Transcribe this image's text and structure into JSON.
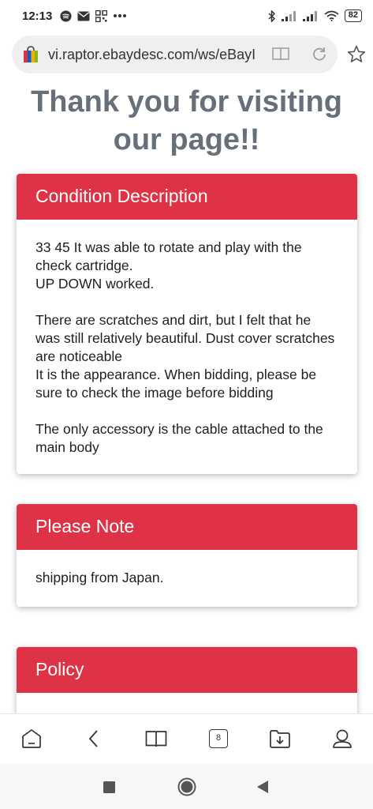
{
  "status_bar": {
    "time": "12:13",
    "battery": "82"
  },
  "browser": {
    "url": "vi.raptor.ebaydesc.com/ws/eBayIS",
    "tab_count": "8"
  },
  "page": {
    "title": "Thank you for visiting our page!!",
    "cards": [
      {
        "header": "Condition Description",
        "paragraphs": [
          "33 45 It was able to rotate and play with the check cartridge.",
          "UP DOWN worked.",
          "",
          "There are scratches and dirt, but I felt that he was still relatively beautiful. Dust cover scratches are noticeable",
          "It is the appearance. When bidding, please be sure to check the image before bidding",
          "",
          "The only accessory is the cable attached to the main body"
        ]
      },
      {
        "header": "Please Note",
        "paragraphs": [
          "shipping from Japan."
        ]
      },
      {
        "header": "Policy",
        "paragraphs": []
      }
    ]
  },
  "colors": {
    "card_header": "#de3346",
    "title": "#67707a"
  }
}
